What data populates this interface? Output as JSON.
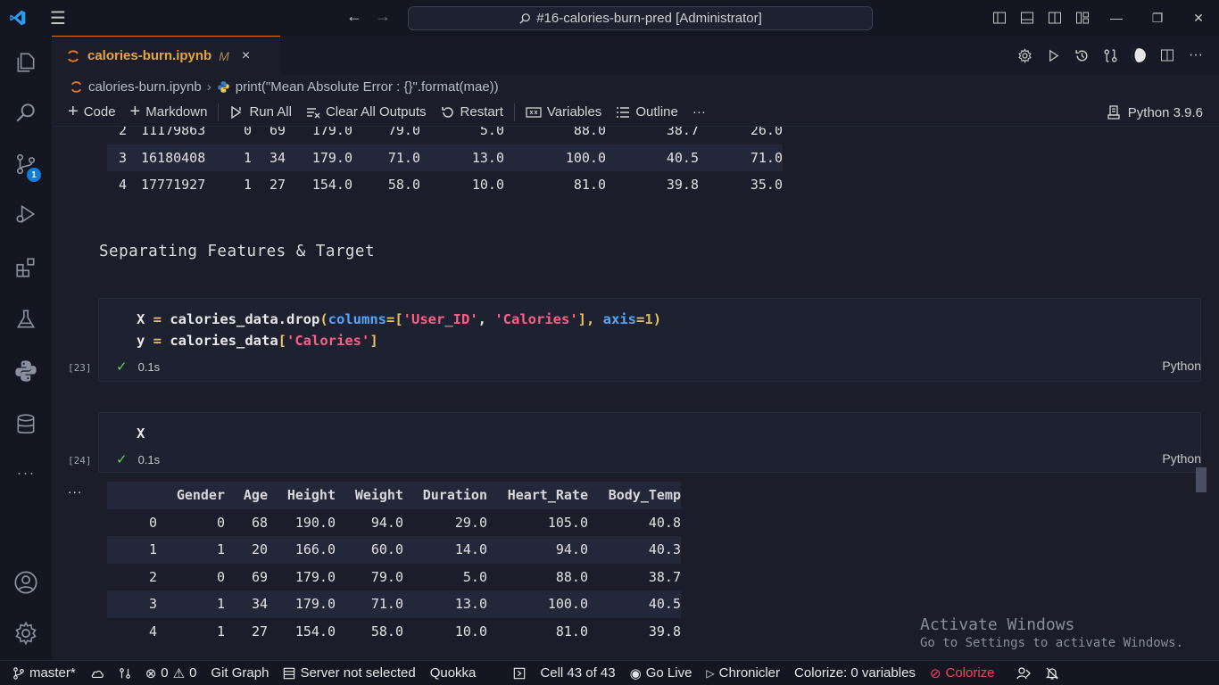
{
  "titlebar": {
    "search_text": "#16-calories-burn-pred [Administrator]"
  },
  "activitybar": {
    "scm_badge": "1",
    "items": [
      "explorer-icon",
      "search-icon",
      "source-control-icon",
      "run-debug-icon",
      "extensions-icon",
      "testing-icon",
      "python-icon",
      "database-icon",
      "more-icon",
      "account-icon",
      "settings-icon"
    ]
  },
  "tab": {
    "title": "calories-burn.ipynb",
    "modified": "M",
    "close": "×"
  },
  "breadcrumb": {
    "file": "calories-burn.ipynb",
    "symbol": "print(\"Mean Absolute Error : {}\".format(mae))"
  },
  "toolbar": {
    "code": "Code",
    "markdown": "Markdown",
    "run_all": "Run All",
    "clear_outputs": "Clear All Outputs",
    "restart": "Restart",
    "variables": "Variables",
    "outline": "Outline",
    "more": "···",
    "kernel": "Python 3.9.6"
  },
  "top_table": {
    "rows": [
      [
        "2",
        "11179863",
        "0",
        "69",
        "179.0",
        "79.0",
        "5.0",
        "88.0",
        "38.7",
        "26.0"
      ],
      [
        "3",
        "16180408",
        "1",
        "34",
        "179.0",
        "71.0",
        "13.0",
        "100.0",
        "40.5",
        "71.0"
      ],
      [
        "4",
        "17771927",
        "1",
        "27",
        "154.0",
        "58.0",
        "10.0",
        "81.0",
        "39.8",
        "35.0"
      ]
    ]
  },
  "markdown_cell": {
    "text": "Separating Features & Target"
  },
  "cell23": {
    "line1": {
      "a": "X ",
      "b": "=",
      "c": " calories_data.drop",
      "d": "(",
      "e": "columns",
      "f": "=[",
      "g": "'User_ID'",
      "h": ", ",
      "i": "'Calories'",
      "j": "], ",
      "k": "axis",
      "l": "=",
      "m": "1",
      "n": ")"
    },
    "line2": {
      "a": "y ",
      "b": "=",
      "c": " calories_data",
      "d": "[",
      "e": "'Calories'",
      "f": "]"
    },
    "exec_count": "[23]",
    "time": "0.1s",
    "lang": "Python"
  },
  "cell24": {
    "code": "X",
    "exec_count": "[24]",
    "time": "0.1s",
    "lang": "Python"
  },
  "output_dots": "...",
  "df": {
    "columns": [
      "",
      "Gender",
      "Age",
      "Height",
      "Weight",
      "Duration",
      "Heart_Rate",
      "Body_Temp"
    ],
    "rows": [
      [
        "0",
        "0",
        "68",
        "190.0",
        "94.0",
        "29.0",
        "105.0",
        "40.8"
      ],
      [
        "1",
        "1",
        "20",
        "166.0",
        "60.0",
        "14.0",
        "94.0",
        "40.3"
      ],
      [
        "2",
        "0",
        "69",
        "179.0",
        "79.0",
        "5.0",
        "88.0",
        "38.7"
      ],
      [
        "3",
        "1",
        "34",
        "179.0",
        "71.0",
        "13.0",
        "100.0",
        "40.5"
      ],
      [
        "4",
        "1",
        "27",
        "154.0",
        "58.0",
        "10.0",
        "81.0",
        "39.8"
      ]
    ]
  },
  "watermark": {
    "line1": "Activate Windows",
    "line2": "Go to Settings to activate Windows."
  },
  "statusbar": {
    "branch": "master*",
    "errors": "0",
    "warnings": "0",
    "git_graph": "Git Graph",
    "server": "Server not selected",
    "quokka": "Quokka",
    "cell": "Cell 43 of 43",
    "go_live": "Go Live",
    "chronicler": "Chronicler",
    "colorize_vars": "Colorize: 0 variables",
    "colorize": "Colorize"
  }
}
